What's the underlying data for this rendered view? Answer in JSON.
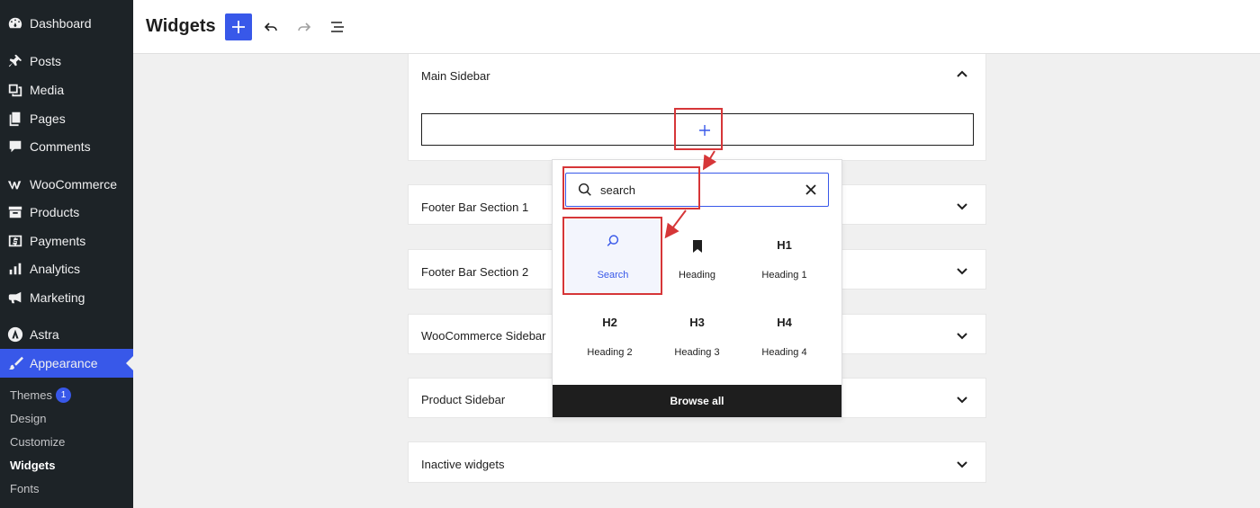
{
  "colors": {
    "sidebar_bg": "#1d2327",
    "accent": "#3858e9",
    "annotation": "#d63638",
    "browse_bg": "#1e1e1e"
  },
  "sidebar": {
    "items": [
      {
        "label": "Dashboard",
        "icon": "dashboard-icon"
      },
      {
        "label": "Posts",
        "icon": "pin-icon"
      },
      {
        "label": "Media",
        "icon": "media-icon"
      },
      {
        "label": "Pages",
        "icon": "pages-icon"
      },
      {
        "label": "Comments",
        "icon": "comment-icon"
      },
      {
        "label": "WooCommerce",
        "icon": "woocommerce-icon"
      },
      {
        "label": "Products",
        "icon": "archive-icon"
      },
      {
        "label": "Payments",
        "icon": "money-icon"
      },
      {
        "label": "Analytics",
        "icon": "bar-chart-icon"
      },
      {
        "label": "Marketing",
        "icon": "megaphone-icon"
      },
      {
        "label": "Astra",
        "icon": "astra-icon"
      },
      {
        "label": "Appearance",
        "icon": "paintbrush-icon"
      }
    ],
    "submenu": [
      {
        "label": "Themes",
        "badge": "1"
      },
      {
        "label": "Design"
      },
      {
        "label": "Customize"
      },
      {
        "label": "Widgets"
      },
      {
        "label": "Fonts"
      }
    ]
  },
  "header": {
    "title": "Widgets"
  },
  "areas": [
    {
      "title": "Main Sidebar",
      "expanded": true
    },
    {
      "title": "Footer Bar Section 1"
    },
    {
      "title": "Footer Bar Section 2"
    },
    {
      "title": "WooCommerce Sidebar"
    },
    {
      "title": "Product Sidebar"
    },
    {
      "title": "Inactive widgets"
    }
  ],
  "inserter": {
    "search_value": "search",
    "blocks": [
      {
        "label": "Search",
        "glyph": "search-icon",
        "selected": true
      },
      {
        "label": "Heading",
        "glyph": "bookmark-icon"
      },
      {
        "label": "Heading 1",
        "glyph": "H1"
      },
      {
        "label": "Heading 2",
        "glyph": "H2"
      },
      {
        "label": "Heading 3",
        "glyph": "H3"
      },
      {
        "label": "Heading 4",
        "glyph": "H4"
      }
    ],
    "browse_all": "Browse all"
  }
}
